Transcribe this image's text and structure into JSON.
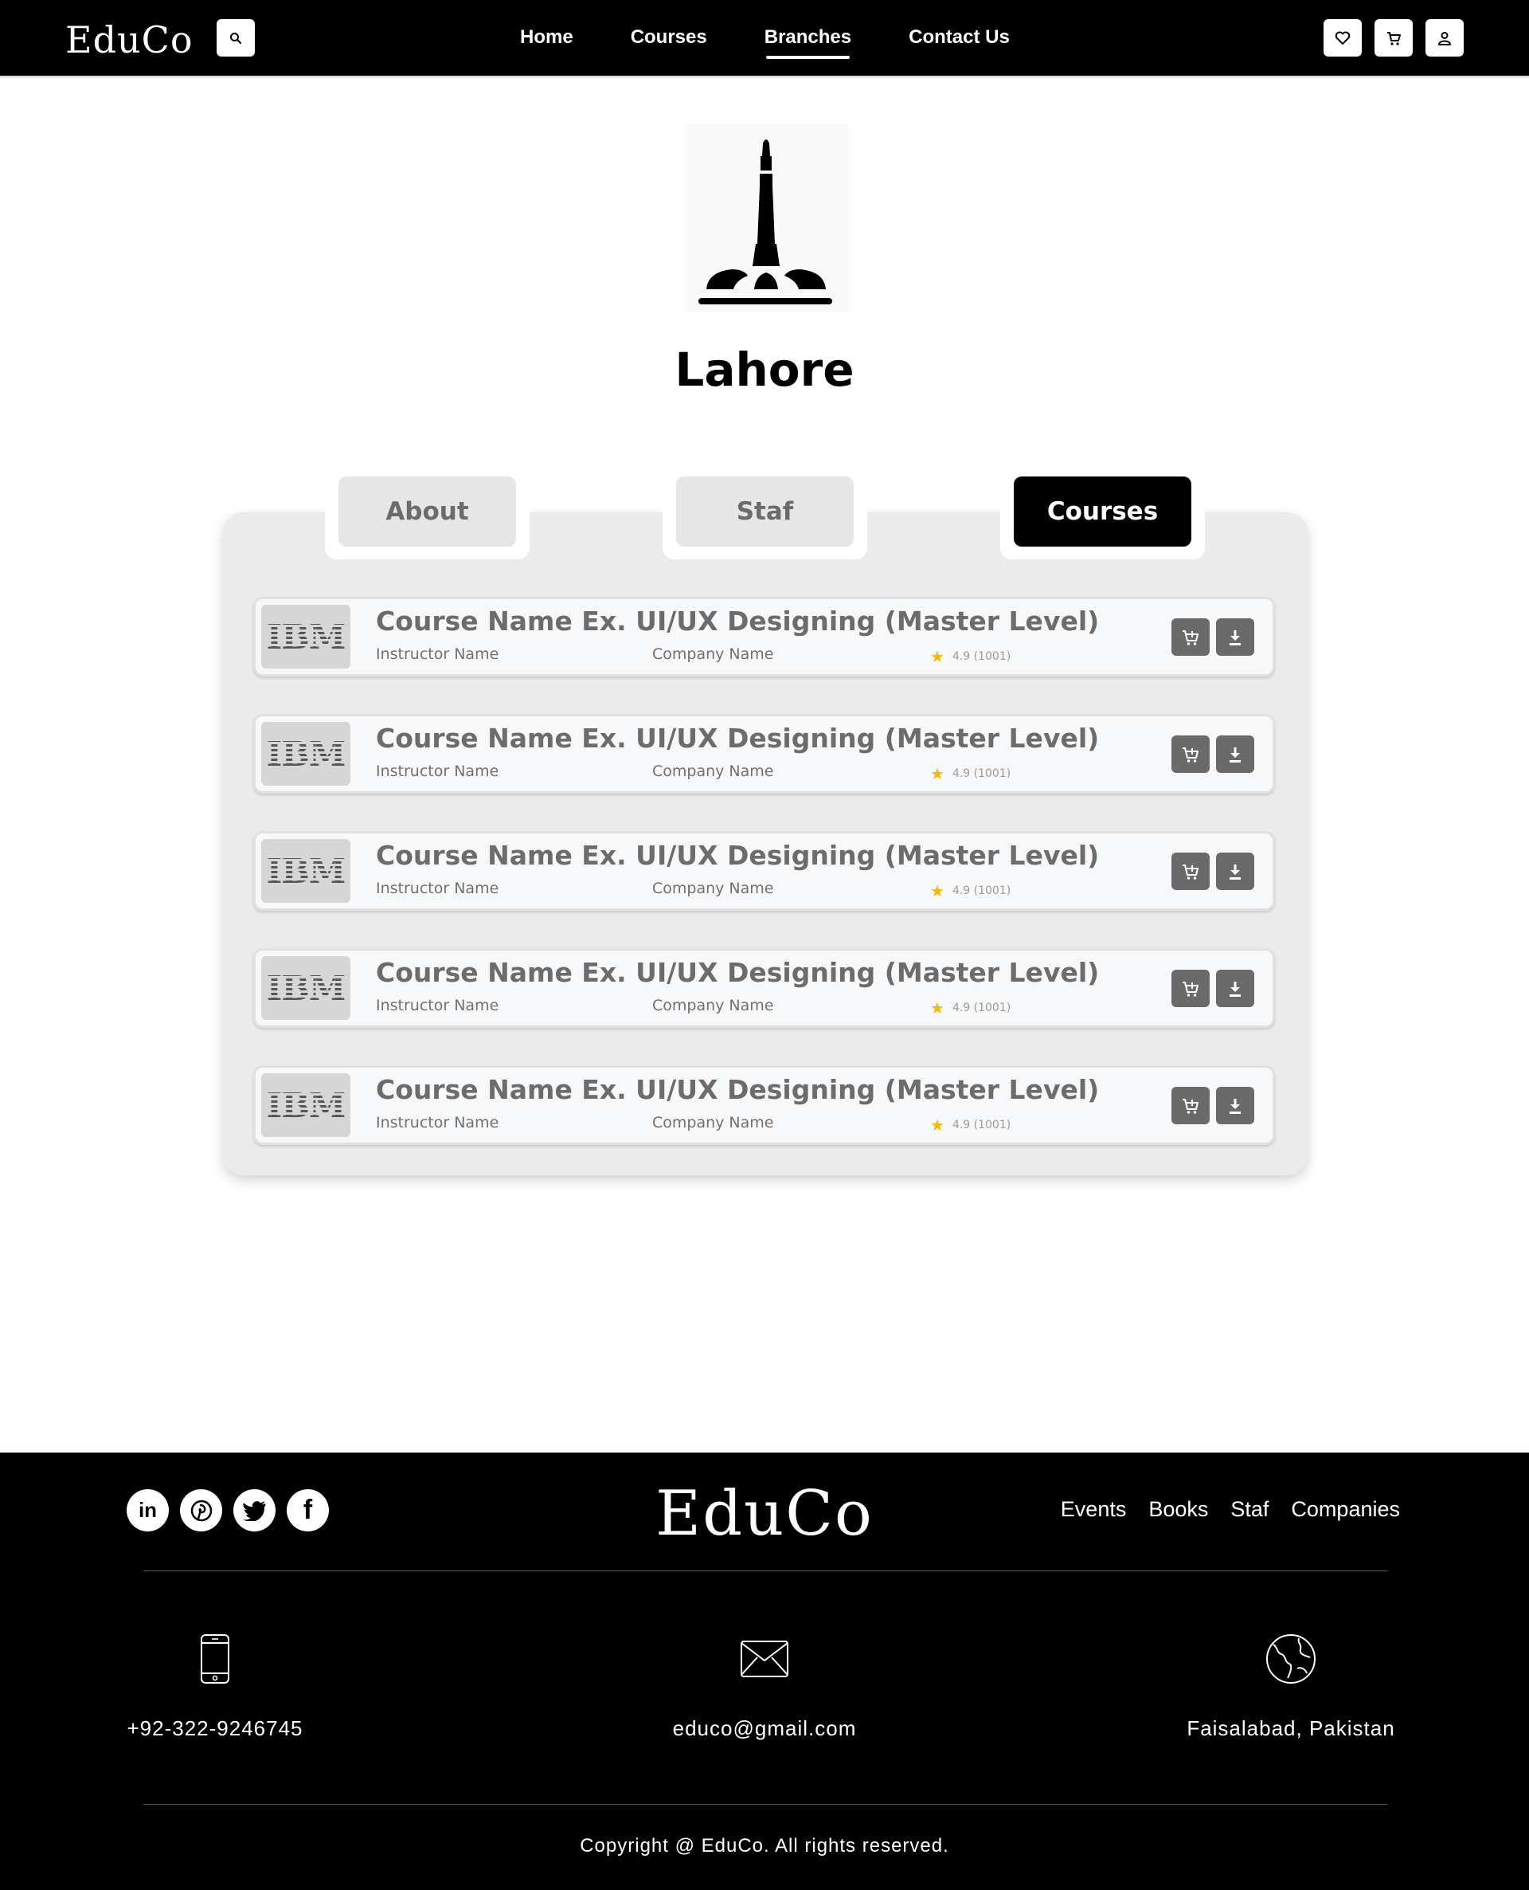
{
  "header": {
    "logo": "EduCo",
    "nav": [
      {
        "label": "Home",
        "active": false
      },
      {
        "label": "Courses",
        "active": false
      },
      {
        "label": "Branches",
        "active": true
      },
      {
        "label": "Contact Us",
        "active": false
      }
    ],
    "icons": [
      "search-icon",
      "heart-icon",
      "cart-icon",
      "user-icon"
    ]
  },
  "branch": {
    "name": "Lahore",
    "image": "minar-e-pakistan-monument-icon"
  },
  "tabs": [
    {
      "label": "About",
      "active": false
    },
    {
      "label": "Staf",
      "active": false
    },
    {
      "label": "Courses",
      "active": true
    }
  ],
  "courses": [
    {
      "logo": "IBM",
      "title": "Course Name Ex. UI/UX Designing (Master Level)",
      "instructor": "Instructor Name",
      "company": "Company Name",
      "rating": "4.9 (1001)"
    },
    {
      "logo": "IBM",
      "title": "Course Name Ex. UI/UX Designing (Master Level)",
      "instructor": "Instructor Name",
      "company": "Company Name",
      "rating": "4.9 (1001)"
    },
    {
      "logo": "IBM",
      "title": "Course Name Ex. UI/UX Designing (Master Level)",
      "instructor": "Instructor Name",
      "company": "Company Name",
      "rating": "4.9 (1001)"
    },
    {
      "logo": "IBM",
      "title": "Course Name Ex. UI/UX Designing (Master Level)",
      "instructor": "Instructor Name",
      "company": "Company Name",
      "rating": "4.9 (1001)"
    },
    {
      "logo": "IBM",
      "title": "Course Name Ex. UI/UX Designing (Master Level)",
      "instructor": "Instructor Name",
      "company": "Company Name",
      "rating": "4.9 (1001)"
    }
  ],
  "footer": {
    "logo": "EduCo",
    "social": [
      "linkedin-icon",
      "pinterest-icon",
      "twitter-icon",
      "facebook-icon"
    ],
    "links": [
      "Events",
      "Books",
      "Staf",
      "Companies"
    ],
    "phone": "+92-322-9246745",
    "email": "educo@gmail.com",
    "location": "Faisalabad, Pakistan",
    "copyright": "Copyright @ EduCo. All rights reserved."
  },
  "colors": {
    "nav_bg": "#000000",
    "panel_bg": "#ebebeb",
    "tab_active": "#000000",
    "tab_inactive": "#e6e6e6",
    "card_button": "#6a6a6a",
    "star": "#f5b800"
  }
}
